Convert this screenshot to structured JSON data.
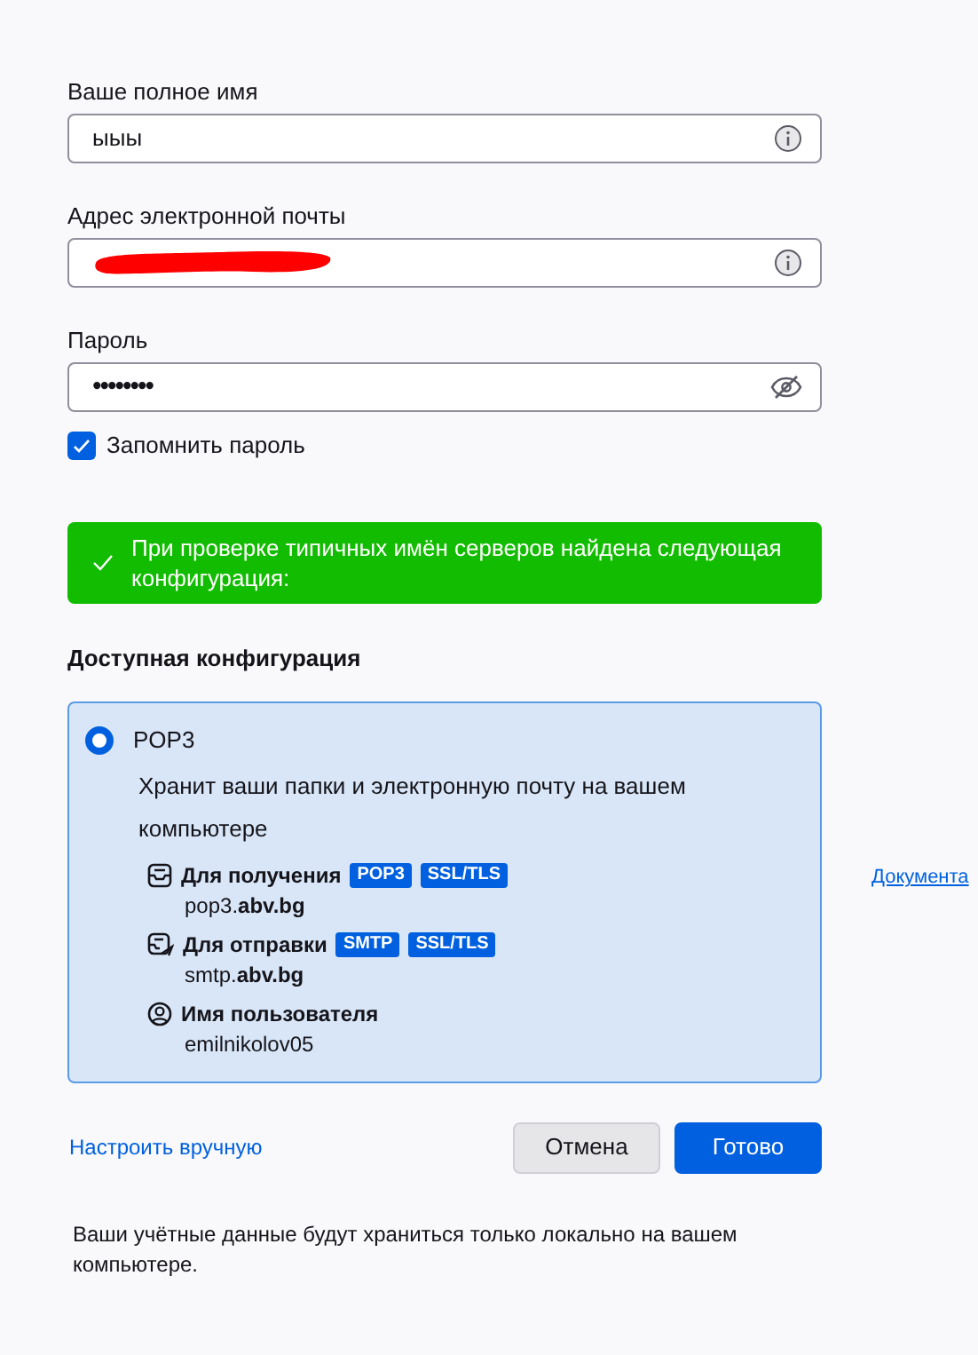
{
  "fields": [
    {
      "label": "Ваше полное имя",
      "kind": "text",
      "value": "ыыы"
    },
    {
      "label": "Адрес электронной почты",
      "kind": "email",
      "redacted": true
    },
    {
      "label": "Пароль",
      "kind": "password",
      "value": "••••••••"
    }
  ],
  "remember": {
    "label": "Запомнить пароль",
    "checked": true
  },
  "banner": {
    "kind": "success",
    "text": "При проверке типичных имён серверов найдена следующая конфигурация:"
  },
  "config_heading": "Доступная конфигурация",
  "config": {
    "name": "POP3",
    "selected": true,
    "description": "Хранит ваши папки и электронную почту на вашем компьютере",
    "servers": [
      {
        "kind": "incoming",
        "label": "Для получения",
        "tags": [
          "POP3",
          "SSL/TLS"
        ],
        "value": "pop3.**abv.bg**"
      },
      {
        "kind": "outgoing",
        "label": "Для отправки",
        "tags": [
          "SMTP",
          "SSL/TLS"
        ],
        "value": "smtp.**abv.bg**"
      },
      {
        "kind": "user",
        "label": "Имя пользователя",
        "value": "emilnikolov05"
      }
    ]
  },
  "side_link": "Документа",
  "manual_link": "Настроить вручную",
  "buttons": [
    {
      "label": "Отмена",
      "kind": "secondary"
    },
    {
      "label": "Готово",
      "kind": "primary"
    }
  ],
  "footer": "Ваши учётные данные будут храниться только локально на вашем компьютере."
}
